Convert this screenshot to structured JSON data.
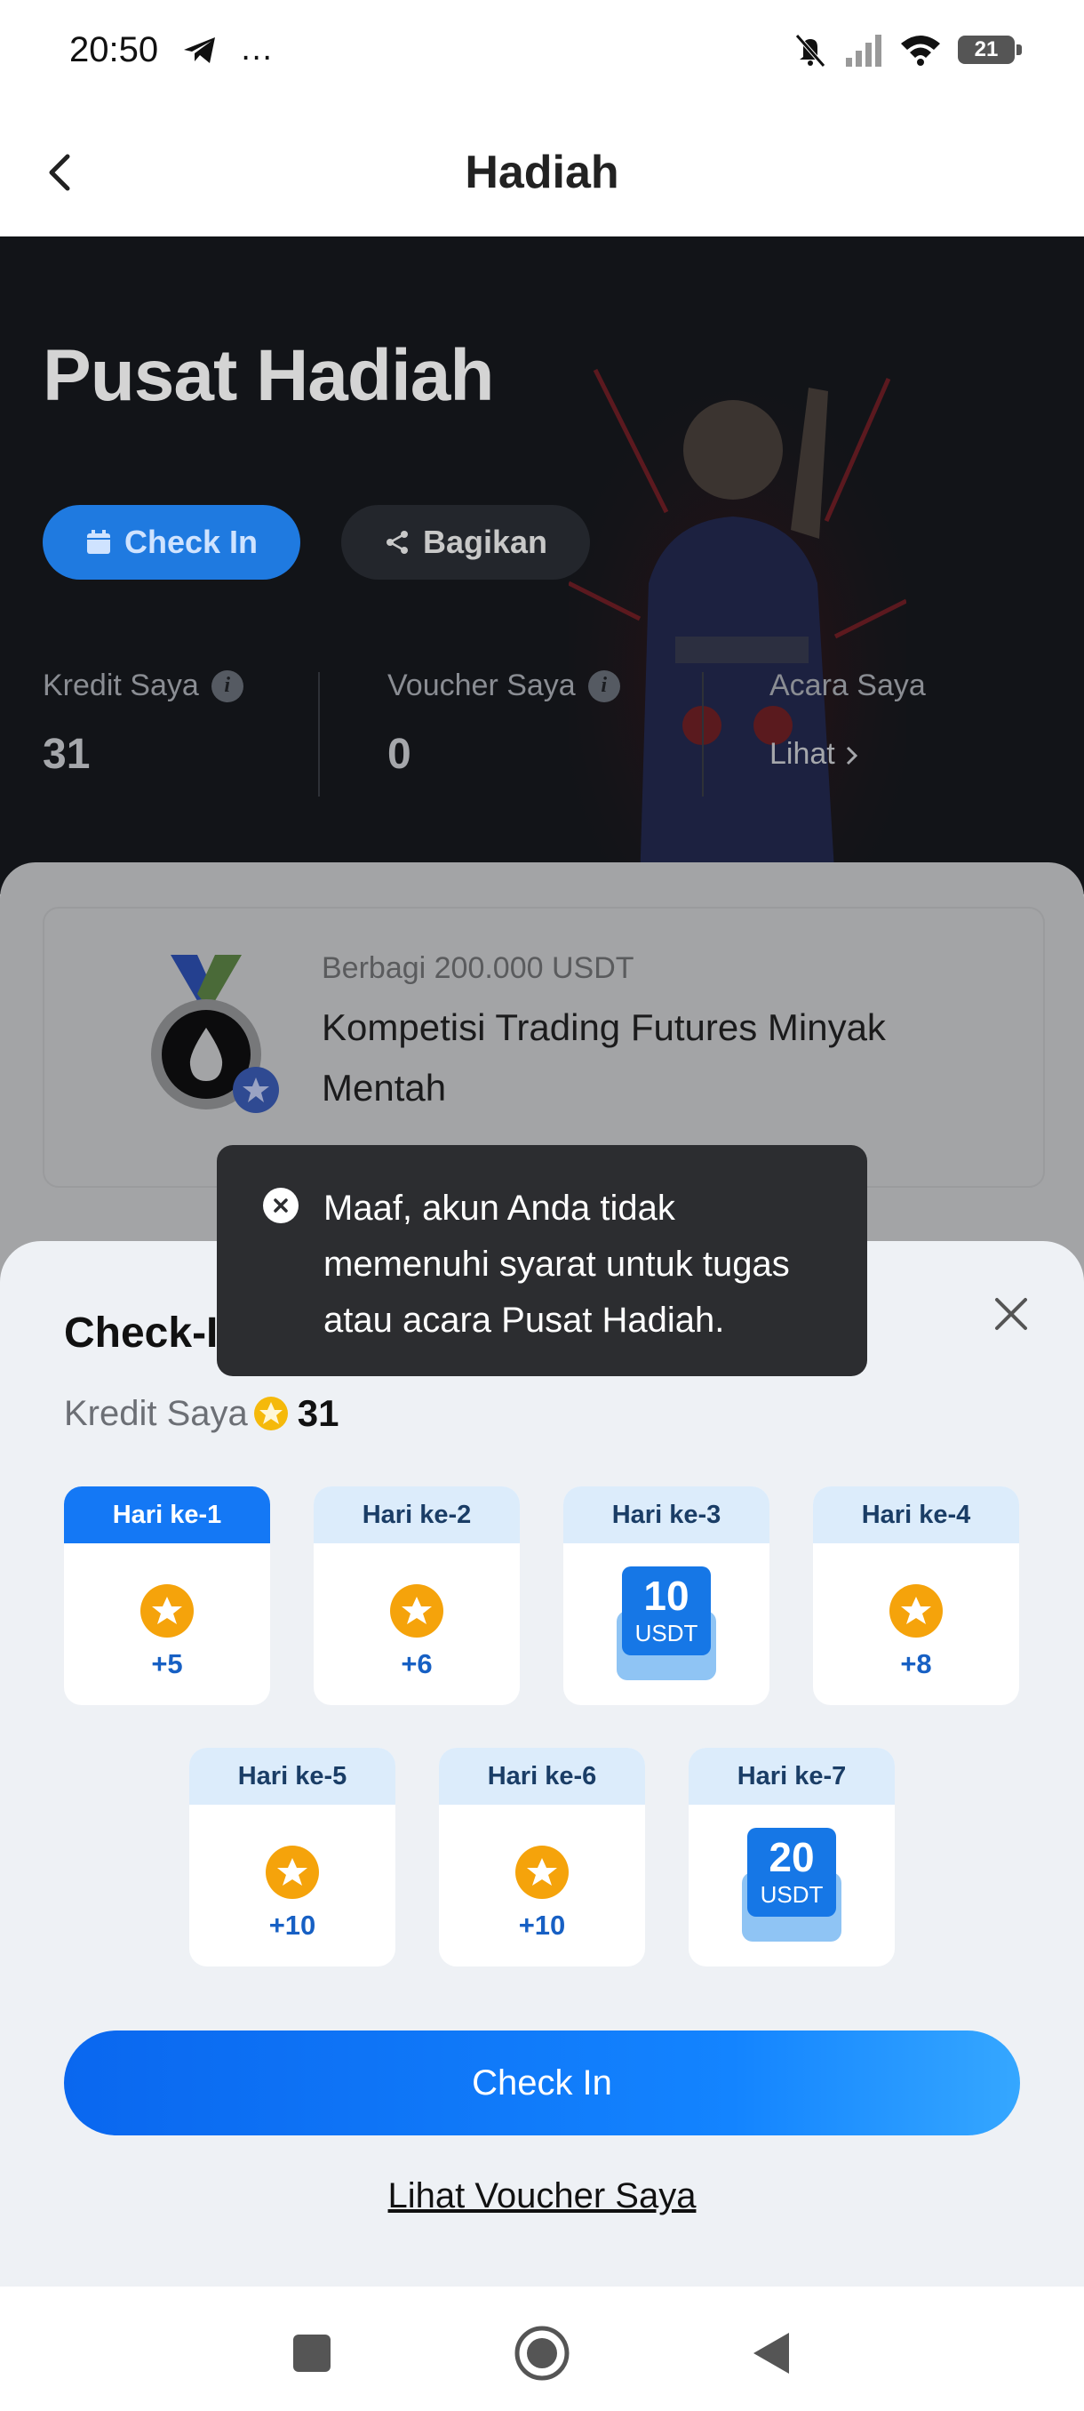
{
  "status_bar": {
    "time": "20:50",
    "extra_icons": "…",
    "battery": "21"
  },
  "header": {
    "title": "Hadiah"
  },
  "hero": {
    "title": "Pusat Hadiah",
    "checkin_label": "Check In",
    "share_label": "Bagikan",
    "stats": [
      {
        "label": "Kredit Saya",
        "value": "31"
      },
      {
        "label": "Voucher Saya",
        "value": "0"
      },
      {
        "label": "Acara Saya",
        "link": "Lihat"
      }
    ]
  },
  "campaign": {
    "subtitle": "Berbagi 200.000 USDT",
    "title": "Kompetisi Trading Futures Minyak Mentah"
  },
  "sheet": {
    "title": "Check-I",
    "credits_label": "Kredit Saya",
    "credits_value": "31",
    "days": [
      {
        "label": "Hari ke-1",
        "reward": "+5",
        "type": "credit",
        "active": true
      },
      {
        "label": "Hari ke-2",
        "reward": "+6",
        "type": "credit"
      },
      {
        "label": "Hari ke-3",
        "amount": "10",
        "unit": "USDT",
        "type": "usdt"
      },
      {
        "label": "Hari ke-4",
        "reward": "+8",
        "type": "credit"
      },
      {
        "label": "Hari ke-5",
        "reward": "+10",
        "type": "credit"
      },
      {
        "label": "Hari ke-6",
        "reward": "+10",
        "type": "credit"
      },
      {
        "label": "Hari ke-7",
        "amount": "20",
        "unit": "USDT",
        "type": "usdt"
      }
    ],
    "cta_label": "Check In",
    "link_label": "Lihat Voucher Saya"
  },
  "toast": {
    "message": "Maaf, akun Anda tidak memenuhi syarat untuk tugas atau acara Pusat Hadiah."
  },
  "colors": {
    "primary": "#1478f5",
    "hero_bg": "#121418",
    "sheet_bg": "#eef1f5",
    "star": "#f5a30b"
  }
}
